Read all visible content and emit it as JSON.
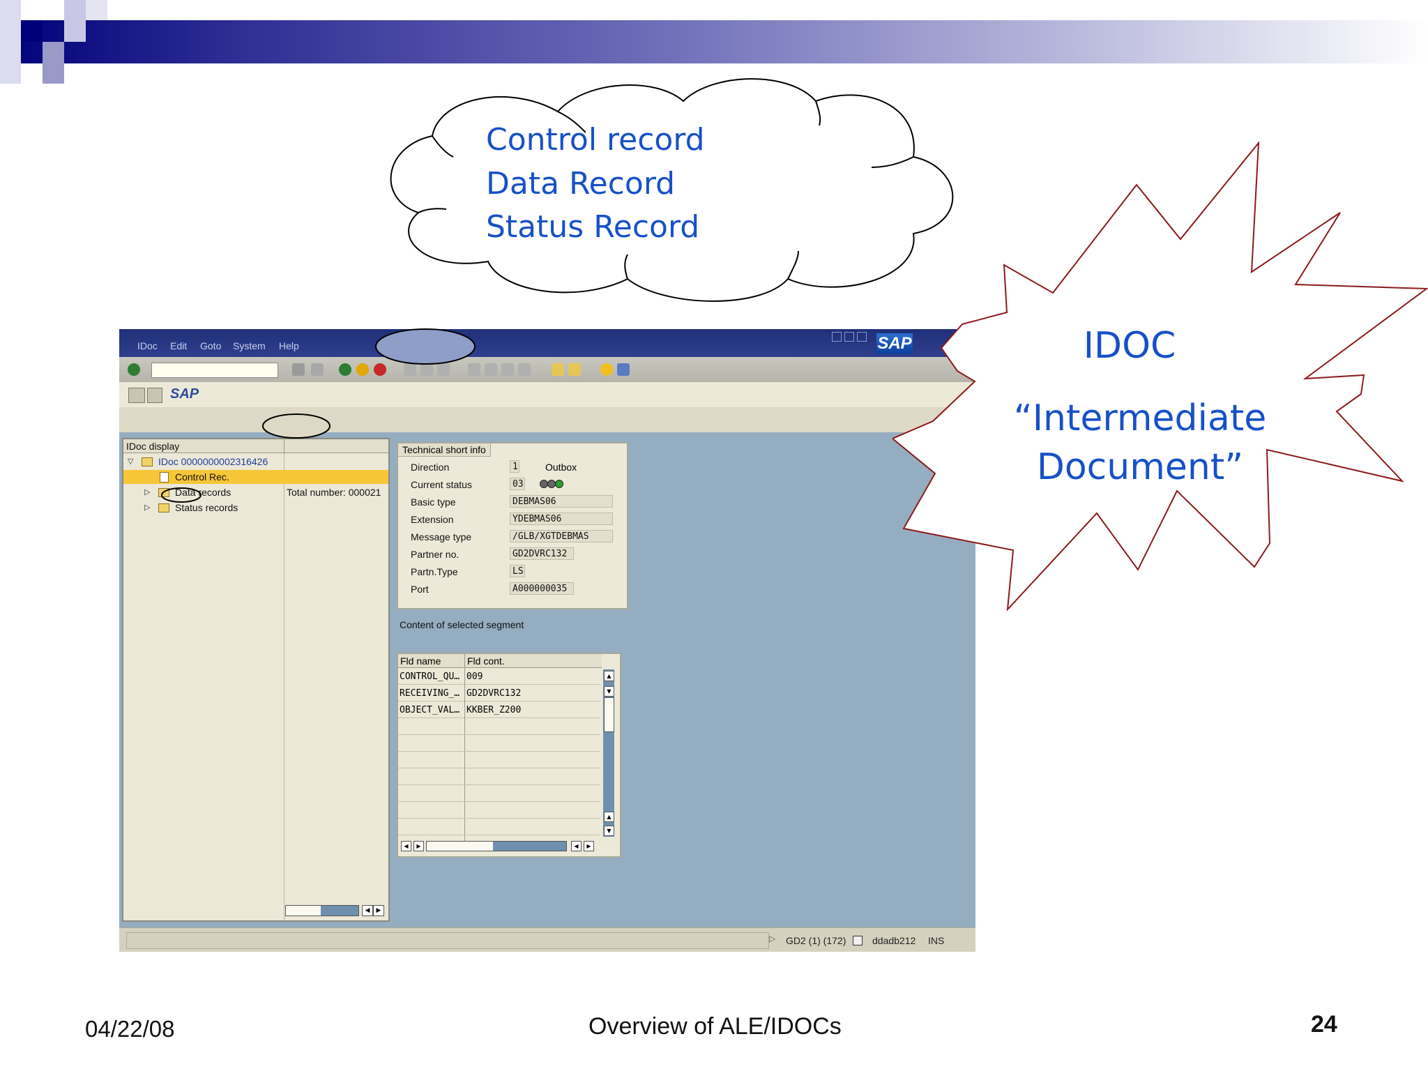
{
  "cloud": {
    "lines": [
      "Control record",
      "Data Record",
      "Status Record"
    ]
  },
  "starburst": {
    "title": "IDOC",
    "subtitle_line1": "“Intermediate",
    "subtitle_line2": "Document”"
  },
  "sap": {
    "menu": [
      "IDoc",
      "Edit",
      "Goto",
      "System",
      "Help"
    ],
    "logo": "SAP",
    "title": "SAP",
    "tree": {
      "header": "IDoc display",
      "root": "IDoc 0000000002316426",
      "items": [
        "Control Rec.",
        "Data records",
        "Status records"
      ],
      "total_number": "Total number: 000021"
    },
    "tech_info": {
      "tab": "Technical short info",
      "rows": [
        {
          "label": "Direction",
          "value": "1"
        },
        {
          "label": "Current status",
          "value": "03"
        },
        {
          "label": "Basic type",
          "value": "DEBMAS06"
        },
        {
          "label": "Extension",
          "value": "YDEBMAS06"
        },
        {
          "label": "Message type",
          "value": "/GLB/XGTDEBMAS"
        },
        {
          "label": "Partner no.",
          "value": "GD2DVRC132"
        },
        {
          "label": "Partn.Type",
          "value": "LS"
        },
        {
          "label": "Port",
          "value": "A000000035"
        }
      ],
      "direction_text": "Outbox"
    },
    "segment": {
      "caption": "Content of selected segment",
      "columns": [
        "Fld name",
        "Fld cont."
      ],
      "rows": [
        [
          "CONTROL_QU…",
          "009"
        ],
        [
          "RECEIVING_…",
          "GD2DVRC132"
        ],
        [
          "OBJECT_VAL…",
          "KKBER_Z200"
        ]
      ]
    },
    "status_bar": {
      "system": "GD2 (1) (172)",
      "host": "ddadb212",
      "mode": "INS"
    }
  },
  "footer": {
    "date": "04/22/08",
    "title": "Overview of ALE/IDOCs",
    "page": "24"
  },
  "colors": {
    "accent_text": "#1750c8",
    "header_band": "#00007a",
    "sap_body": "#95adc0",
    "highlight_row": "#f6c638"
  }
}
